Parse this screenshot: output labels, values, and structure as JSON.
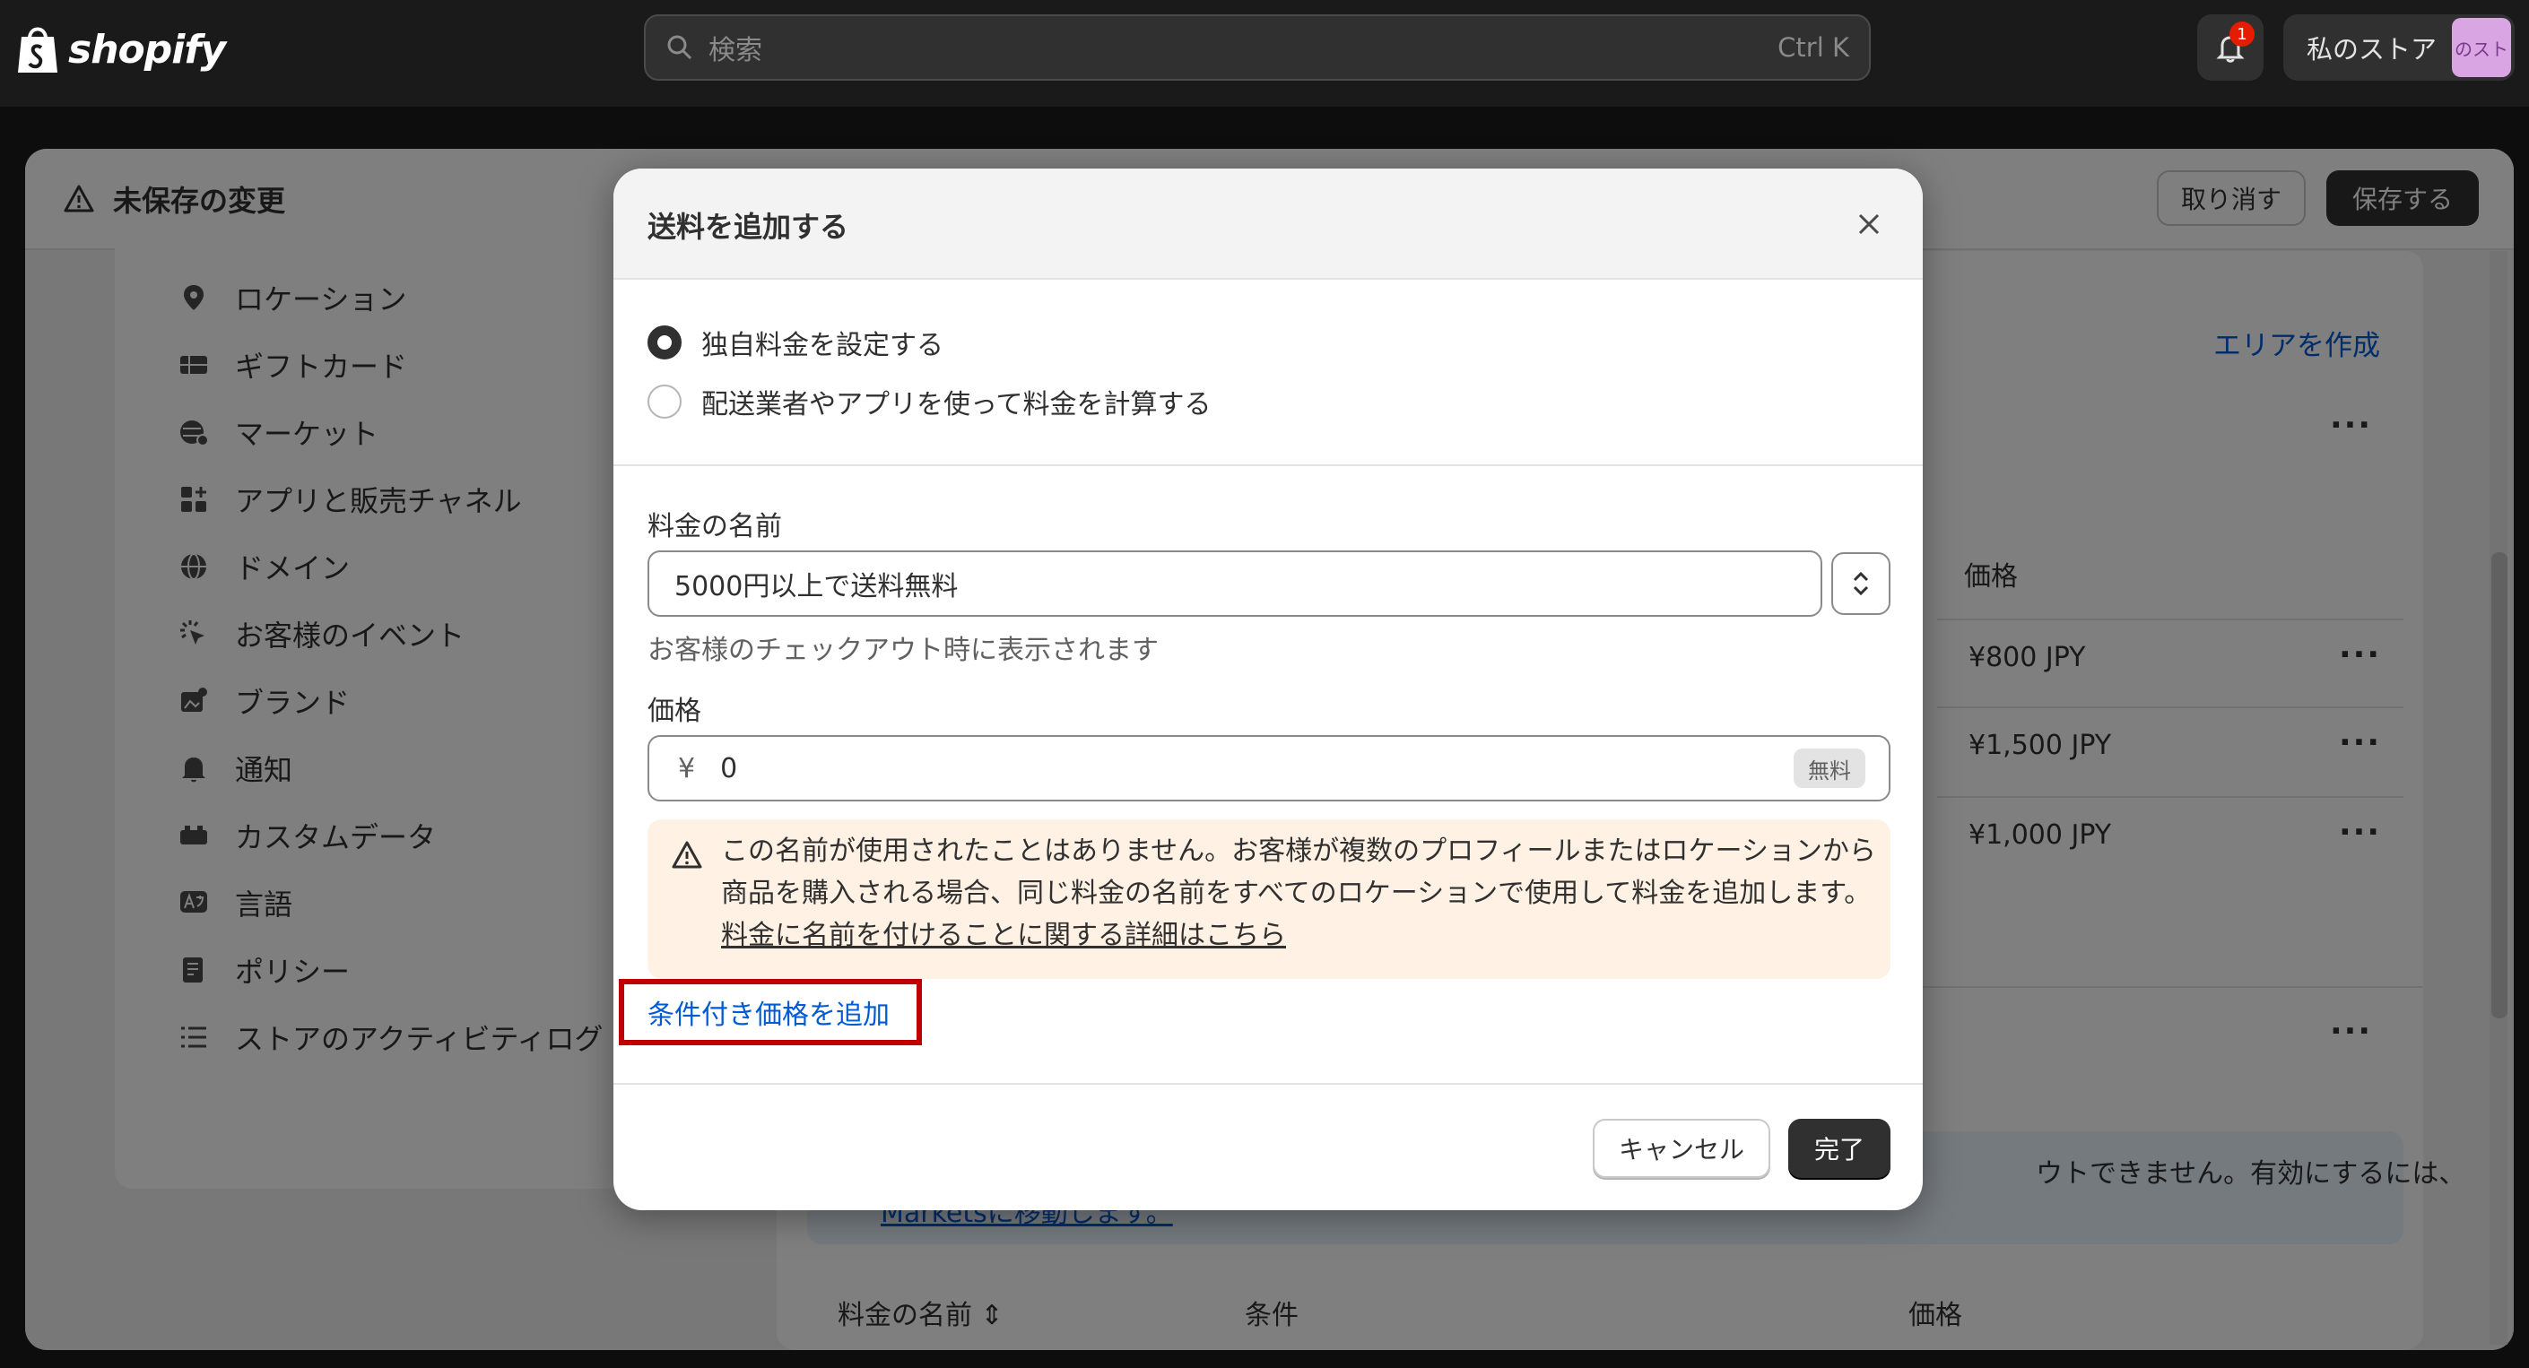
{
  "topbar": {
    "logo_text": "shopify",
    "search_placeholder": "検索",
    "search_shortcut": "Ctrl K",
    "notification_count": "1",
    "store_name": "私のストア",
    "store_avatar_text": "のスト"
  },
  "unsaved": {
    "title": "未保存の変更",
    "discard_label": "取り消す",
    "save_label": "保存する"
  },
  "sidebar": {
    "items": [
      {
        "label": "ロケーション",
        "icon": "location-pin-icon"
      },
      {
        "label": "ギフトカード",
        "icon": "gift-card-icon"
      },
      {
        "label": "マーケット",
        "icon": "globe-market-icon"
      },
      {
        "label": "アプリと販売チャネル",
        "icon": "apps-icon"
      },
      {
        "label": "ドメイン",
        "icon": "globe-icon"
      },
      {
        "label": "お客様のイベント",
        "icon": "sparkle-cursor-icon"
      },
      {
        "label": "ブランド",
        "icon": "brand-image-icon"
      },
      {
        "label": "通知",
        "icon": "bell-icon"
      },
      {
        "label": "カスタムデータ",
        "icon": "database-icon"
      },
      {
        "label": "言語",
        "icon": "language-icon"
      },
      {
        "label": "ポリシー",
        "icon": "policy-icon"
      },
      {
        "label": "ストアのアクティビティログ",
        "icon": "list-icon"
      }
    ]
  },
  "background": {
    "create_area": "エリアを作成",
    "price_header": "価格",
    "prices": [
      "¥800 JPY",
      "¥1,500 JPY",
      "¥1,000 JPY"
    ],
    "banner_text": "ウトできません。有効にするには、",
    "banner_link": "Marketsに移動します。",
    "bottom_headers": [
      "料金の名前",
      "条件",
      "価格"
    ]
  },
  "modal": {
    "title": "送料を追加する",
    "radio_custom": "独自料金を設定する",
    "radio_carrier": "配送業者やアプリを使って料金を計算する",
    "rate_name_label": "料金の名前",
    "rate_name_value": "5000円以上で送料無料",
    "rate_name_help": "お客様のチェックアウト時に表示されます",
    "price_label": "価格",
    "currency_symbol": "¥",
    "price_value": "0",
    "free_badge": "無料",
    "warning_text": "この名前が使用されたことはありません。お客様が複数のプロフィールまたはロケーションから商品を購入される場合、同じ料金の名前をすべてのロケーションで使用して料金を追加します。",
    "warning_link": "料金に名前を付けることに関する詳細はこちら",
    "add_conditional": "条件付き価格を追加",
    "cancel_label": "キャンセル",
    "done_label": "完了"
  }
}
